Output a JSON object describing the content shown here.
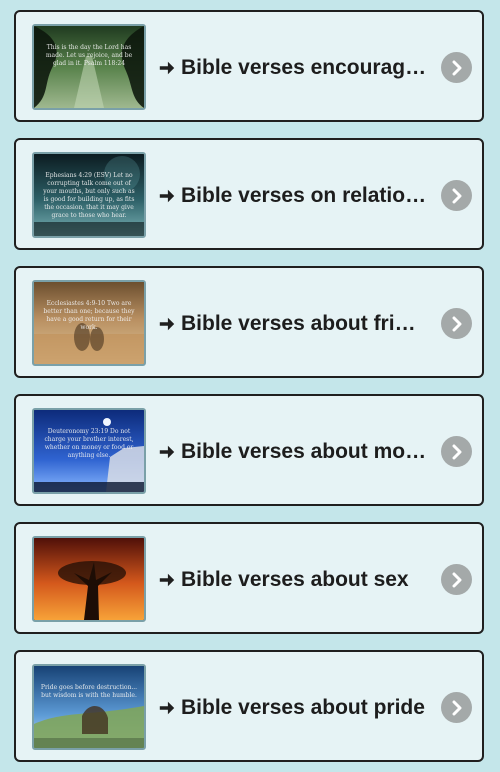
{
  "items": [
    {
      "title": "Bible verses encouraging",
      "thumb_text": "This is the day the Lord has made. Let us rejoice, and be glad in it. Psalm 118:24",
      "thumb_colors": [
        "#203b20",
        "#58824b",
        "#9fb88f"
      ]
    },
    {
      "title": "Bible verses on relationships",
      "thumb_text": "Ephesians 4:29 (ESV) Let no corrupting talk come out of your mouths, but only such as is good for building up, as fits the occasion, that it may give grace to those who hear.",
      "thumb_colors": [
        "#0c1c21",
        "#2c5f66",
        "#7ab2b6"
      ]
    },
    {
      "title": "Bible verses about friendship",
      "thumb_text": "Ecclesiastes 4:9-10 Two are better than one; because they have a good return for their work.",
      "thumb_colors": [
        "#6c4f2f",
        "#b88f61",
        "#e3c798"
      ]
    },
    {
      "title": "Bible verses about money",
      "thumb_text": "Deuteronomy 23:19 Do not charge your brother interest, whether on money or food or anything else.",
      "thumb_colors": [
        "#0d2b7b",
        "#2f63d0",
        "#89b8ff"
      ]
    },
    {
      "title": "Bible verses about sex",
      "thumb_text": "",
      "thumb_colors": [
        "#501009",
        "#d4581c",
        "#f7a238"
      ]
    },
    {
      "title": "Bible verses about pride",
      "thumb_text": "Pride goes before destruction... but wisdom is with the humble.",
      "thumb_colors": [
        "#174275",
        "#5d9bd6",
        "#bfe0f8"
      ]
    }
  ]
}
